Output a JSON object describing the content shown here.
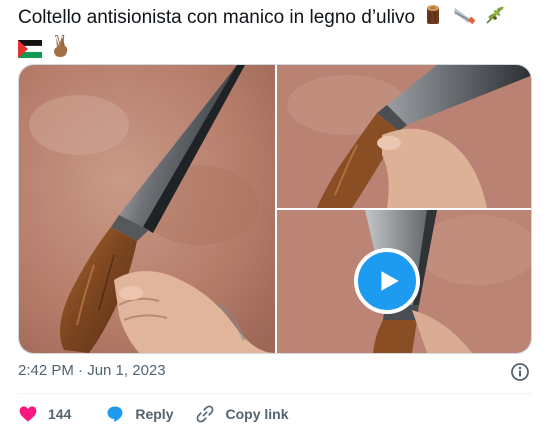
{
  "tweet": {
    "text": "Coltello antisionista con manico in legno d’ulivo",
    "emojis": [
      "wood-log-emoji",
      "saw-emoji",
      "olive-branch-emoji",
      "palestine-flag-emoji",
      "victory-hand-emoji"
    ],
    "timestamp": "2:42 PM · Jun 1, 2023"
  },
  "actions": {
    "like_count": "144",
    "reply_label": "Reply",
    "copy_link_label": "Copy link"
  },
  "colors": {
    "like": "#f91880",
    "reply": "#1d9bf0",
    "play_button": "#1d9bf0",
    "muted_text": "#536471"
  },
  "icons": [
    "heart-icon",
    "reply-bubble-icon",
    "link-icon",
    "info-icon",
    "play-icon"
  ]
}
